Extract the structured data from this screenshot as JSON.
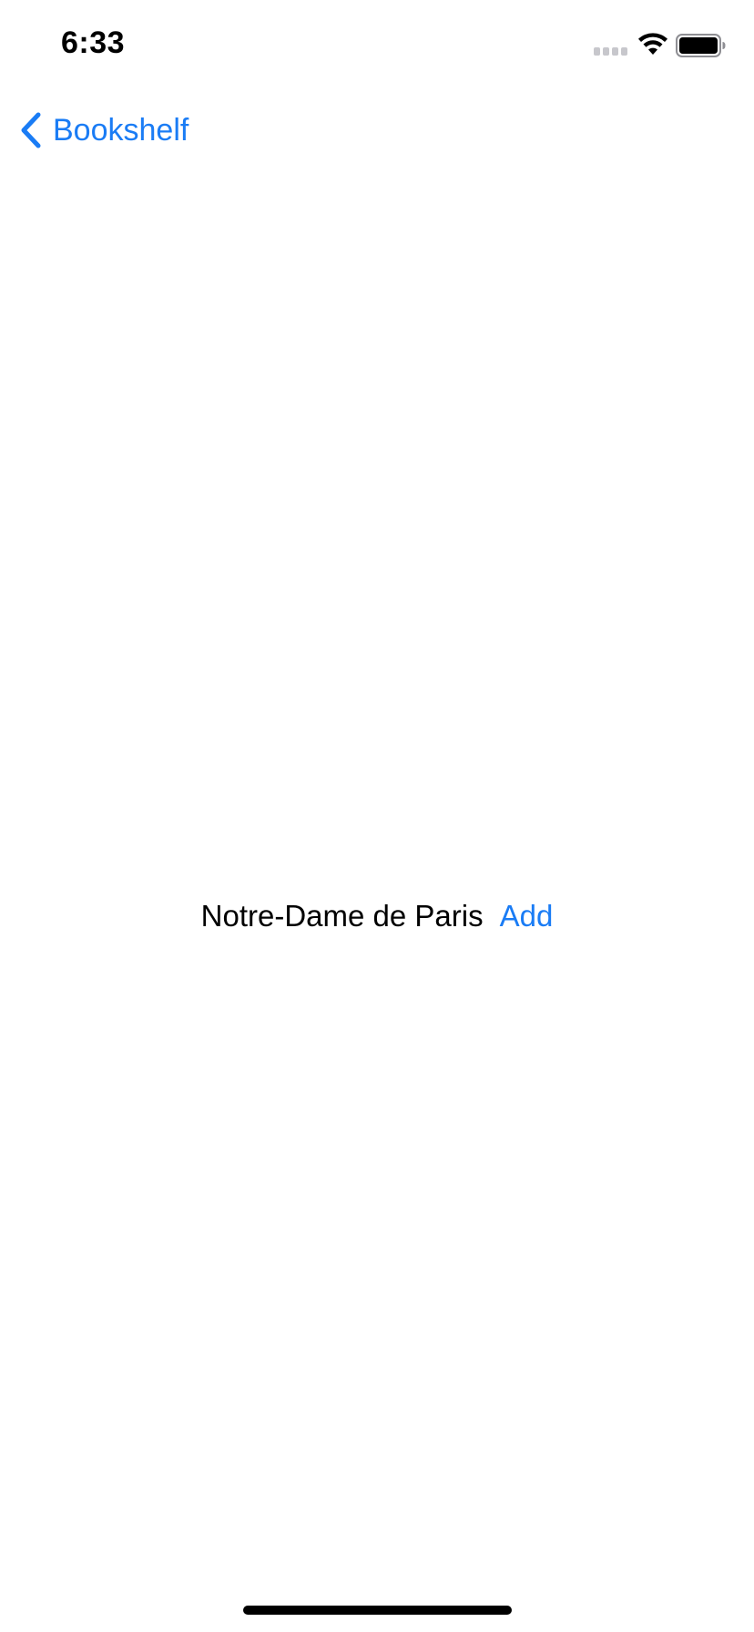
{
  "status_bar": {
    "time": "6:33",
    "icons": [
      "signal-icon",
      "wifi-icon",
      "battery-icon"
    ]
  },
  "nav": {
    "back_label": "Bookshelf",
    "back_icon": "chevron-left-icon"
  },
  "content": {
    "book_title": "Notre-Dame de Paris",
    "add_label": "Add"
  },
  "colors": {
    "accent": "#1a7cf5",
    "text": "#000000",
    "background": "#ffffff"
  }
}
